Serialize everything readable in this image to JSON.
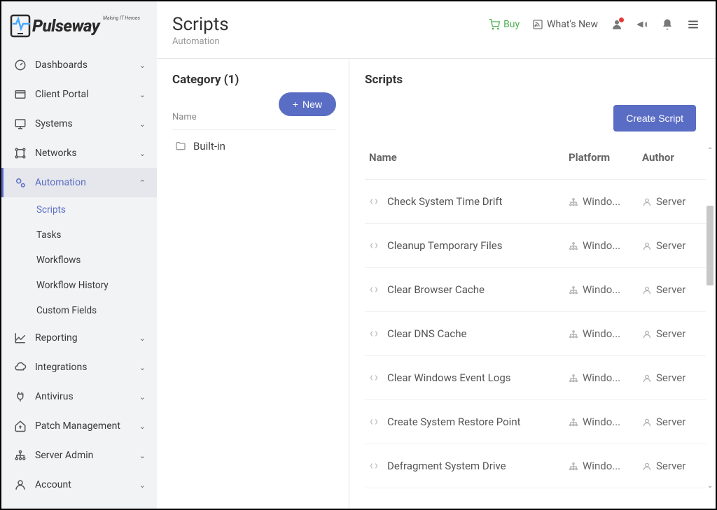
{
  "brand": {
    "name": "Pulseway",
    "tagline": "Making IT Heroes"
  },
  "sidebar": {
    "items": [
      {
        "label": "Dashboards",
        "icon": "gauge-icon"
      },
      {
        "label": "Client Portal",
        "icon": "window-icon"
      },
      {
        "label": "Systems",
        "icon": "monitor-icon"
      },
      {
        "label": "Networks",
        "icon": "network-icon"
      },
      {
        "label": "Automation",
        "icon": "gears-icon"
      },
      {
        "label": "Reporting",
        "icon": "chart-icon"
      },
      {
        "label": "Integrations",
        "icon": "cloud-icon"
      },
      {
        "label": "Antivirus",
        "icon": "plug-icon"
      },
      {
        "label": "Patch Management",
        "icon": "house-up-icon"
      },
      {
        "label": "Server Admin",
        "icon": "org-icon"
      },
      {
        "label": "Account",
        "icon": "user-icon"
      }
    ],
    "automation_children": [
      {
        "label": "Scripts"
      },
      {
        "label": "Tasks"
      },
      {
        "label": "Workflows"
      },
      {
        "label": "Workflow History"
      },
      {
        "label": "Custom Fields"
      }
    ]
  },
  "header": {
    "title": "Scripts",
    "subtitle": "Automation",
    "buy": "Buy",
    "whatsnew": "What's New"
  },
  "category": {
    "header": "Category  (1)",
    "new_label": "New",
    "column_label": "Name",
    "items": [
      {
        "label": "Built-in"
      }
    ]
  },
  "scripts": {
    "header": "Scripts",
    "create_label": "Create Script",
    "columns": {
      "name": "Name",
      "platform": "Platform",
      "author": "Author"
    },
    "rows": [
      {
        "name": "Check System Time Drift",
        "platform": "Windo...",
        "author": "Server"
      },
      {
        "name": "Cleanup Temporary Files",
        "platform": "Windo...",
        "author": "Server"
      },
      {
        "name": "Clear Browser Cache",
        "platform": "Windo...",
        "author": "Server"
      },
      {
        "name": "Clear DNS Cache",
        "platform": "Windo...",
        "author": "Server"
      },
      {
        "name": "Clear Windows Event Logs",
        "platform": "Windo...",
        "author": "Server"
      },
      {
        "name": "Create System Restore Point",
        "platform": "Windo...",
        "author": "Server"
      },
      {
        "name": "Defragment System Drive",
        "platform": "Windo...",
        "author": "Server"
      }
    ]
  }
}
